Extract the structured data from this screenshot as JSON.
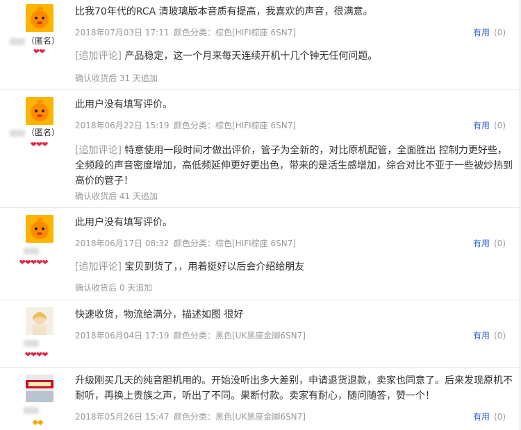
{
  "reviews": [
    {
      "nick_suffix": "（匿名）",
      "level": "❤❤",
      "content": "比我70年代的RCA 清玻璃版本音质有提高，我喜欢的声音，很满意。",
      "date": "2018年07月03日 17:11",
      "sku": "颜色分类：棕色[HIFI棕座 6SN7]",
      "useful_label": "有用",
      "useful_count": "(0)",
      "append_tag": "[追加评论]",
      "append_text": "产品稳定，这一个月来每天连续开机十几个钟无任何问题。",
      "confirm": "确认收货后 31 天追加"
    },
    {
      "nick_suffix": "（匿名）",
      "level": "❤❤❤",
      "content": "此用户没有填写评价。",
      "date": "2018年06月22日 15:19",
      "sku": "颜色分类：棕色[HIFI棕座 6SN7]",
      "useful_label": "有用",
      "useful_count": "(0)",
      "append_tag": "[追加评论]",
      "append_text": "特意使用一段时间才做出评价，管子为全新的，对比原机配管，全面胜出 控制力更好些，全频段的声音密度增加，高低频延伸更好更出色，带来的是活生感增加，综合对比不亚于一些被炒热到高价的管子！",
      "confirm": "确认收货后 41 天追加"
    },
    {
      "nick_suffix": "",
      "level": "❤❤❤❤❤",
      "content": "此用户没有填写评价。",
      "date": "2018年06月17日 08:32",
      "sku": "颜色分类：棕色[HIFI棕座 6SN7]",
      "useful_label": "有用",
      "useful_count": "(0)",
      "append_tag": "[追加评论]",
      "append_text": "宝贝到货了，，用着挺好以后会介绍给朋友",
      "confirm": "确认收货后 0 天追加"
    },
    {
      "nick_suffix": "",
      "level": "❤❤❤❤",
      "content": "快速收货，物流给满分，描述如图 很好",
      "date": "2018年06月04日 17:19",
      "sku": "颜色分类：黑色[UK黑座金脚6SN7]",
      "useful_label": "有用",
      "useful_count": "(0)"
    },
    {
      "nick_suffix": "",
      "level": "◆◆",
      "content": "升级刚买几天的纯音胆机用的。开始没听出多大差别，申请退货退款，卖家也同意了。后来发现原机不耐听，再换上贵族之声，听出了不同。果断付款。卖家有耐心，随问随答，赞一个！",
      "date": "2018年05月26日 15:47",
      "sku": "颜色分类：黑色[UK黑座金脚6SN7]",
      "useful_label": "有用",
      "useful_count": "(0)"
    }
  ]
}
